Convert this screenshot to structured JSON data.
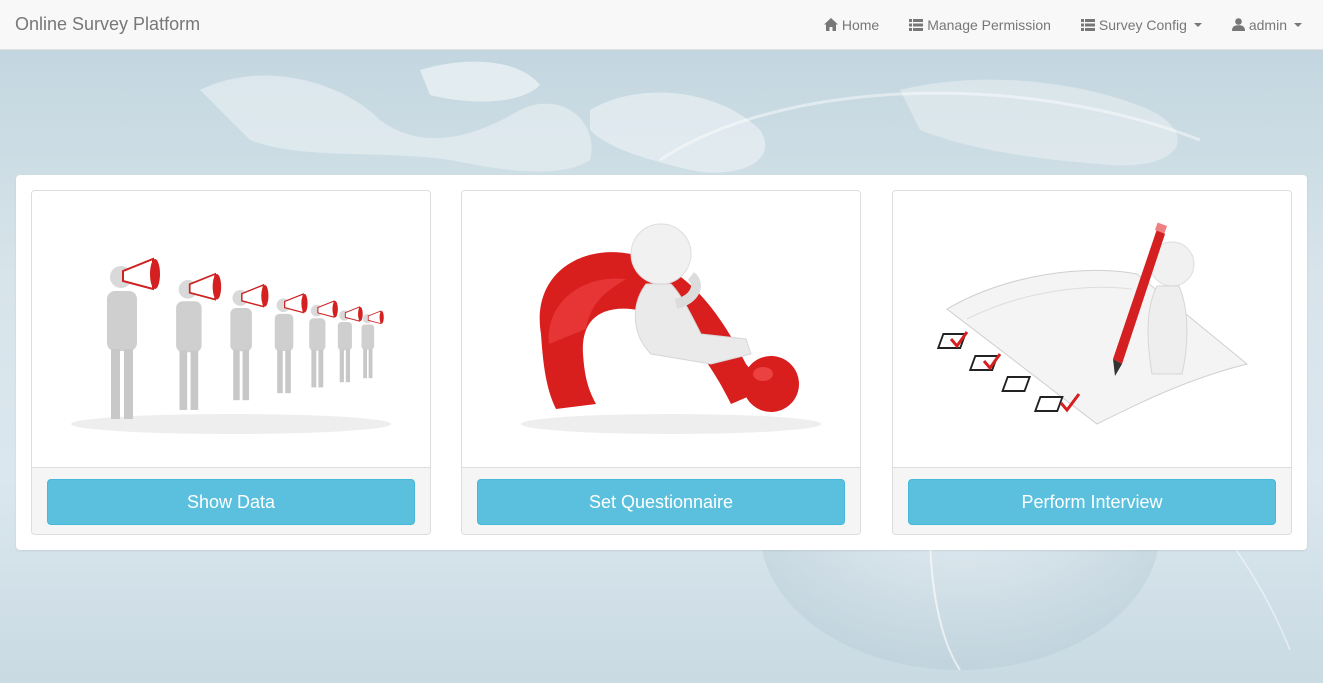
{
  "navbar": {
    "brand": "Online Survey Platform",
    "items": [
      {
        "label": "Home",
        "icon": "home-icon"
      },
      {
        "label": "Manage Permission",
        "icon": "list-icon"
      },
      {
        "label": "Survey Config",
        "icon": "list-icon",
        "dropdown": true
      },
      {
        "label": "admin",
        "icon": "user-icon",
        "dropdown": true
      }
    ]
  },
  "cards": [
    {
      "button_label": "Show Data",
      "image": "megaphone-people-illustration"
    },
    {
      "button_label": "Set Questionnaire",
      "image": "question-mark-figure-illustration"
    },
    {
      "button_label": "Perform Interview",
      "image": "checklist-pencil-figure-illustration"
    }
  ],
  "colors": {
    "navbar_bg": "#f8f8f8",
    "button_bg": "#5bc0de",
    "accent_red": "#d42020"
  }
}
